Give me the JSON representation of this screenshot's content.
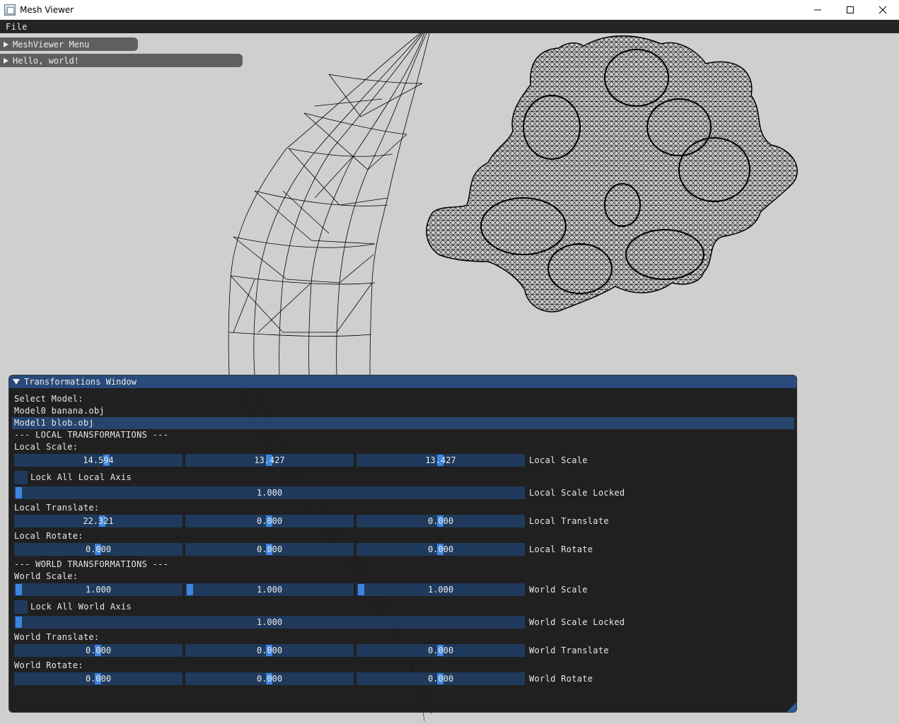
{
  "window": {
    "title": "Mesh Viewer"
  },
  "menubar": {
    "items": [
      "File"
    ]
  },
  "collapsed_windows": {
    "meshviewer_menu": "MeshViewer Menu",
    "hello_world": "Hello, world!"
  },
  "transformations": {
    "title": "Transformations Window",
    "select_model_label": "Select Model:",
    "models": [
      "Model0 banana.obj",
      "Model1 blob.obj"
    ],
    "selected_model": "Model1 blob.obj",
    "local_header": "--- LOCAL TRANSFORMATIONS ---",
    "local_scale_label": "Local Scale:",
    "local_scale": {
      "x": "14.594",
      "y": "13.427",
      "z": "13.427",
      "name": "Local Scale"
    },
    "lock_local": "Lock All Local Axis",
    "local_scale_locked": {
      "value": "1.000",
      "name": "Local Scale Locked"
    },
    "local_translate_label": "Local Translate:",
    "local_translate": {
      "x": "22.321",
      "y": "0.000",
      "z": "0.000",
      "name": "Local Translate"
    },
    "local_rotate_label": "Local Rotate:",
    "local_rotate": {
      "x": "0.000",
      "y": "0.000",
      "z": "0.000",
      "name": "Local Rotate"
    },
    "world_header": "--- WORLD TRANSFORMATIONS ---",
    "world_scale_label": "World Scale:",
    "world_scale": {
      "x": "1.000",
      "y": "1.000",
      "z": "1.000",
      "name": "World Scale"
    },
    "lock_world": "Lock All World Axis",
    "world_scale_locked": {
      "value": "1.000",
      "name": "World Scale Locked"
    },
    "world_translate_label": "World Translate:",
    "world_translate": {
      "x": "0.000",
      "y": "0.000",
      "z": "0.000",
      "name": "World Translate"
    },
    "world_rotate_label": "World Rotate:",
    "world_rotate": {
      "x": "0.000",
      "y": "0.000",
      "z": "0.000",
      "name": "World Rotate"
    }
  },
  "colors": {
    "background": "#cfcfcf",
    "title_bar_active": "#294a7a",
    "slider_grab": "#3d85e0",
    "frame_bg": "#1f3a5c",
    "header_selected": "#26446e",
    "wireframe": "#000000"
  }
}
